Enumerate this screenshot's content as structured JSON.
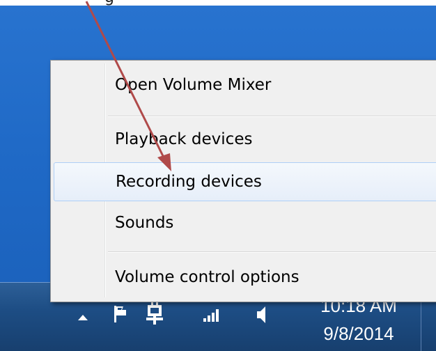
{
  "caption_fragment": "g",
  "menu": {
    "items": [
      {
        "label": "Open Volume Mixer"
      },
      {
        "label": "Playback devices"
      },
      {
        "label": "Recording devices"
      },
      {
        "label": "Sounds"
      },
      {
        "label": "Volume control options"
      }
    ],
    "highlighted_item": "Recording devices"
  },
  "taskbar": {
    "clock_time": "10:18 AM",
    "clock_date": "9/8/2014",
    "tray_icons": [
      "show-hidden-icons-chevron",
      "action-center-flag",
      "power-plug",
      "network-signal",
      "speaker-volume"
    ]
  },
  "annotation": {
    "arrow_color": "#b04a4a"
  }
}
